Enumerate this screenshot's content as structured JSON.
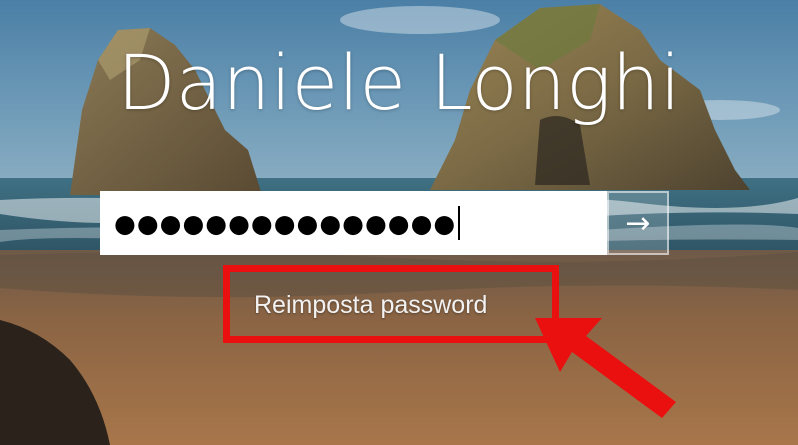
{
  "user": {
    "name": "Daniele Longhi"
  },
  "password": {
    "masked_value": "●●●●●●●●●●●●●●●"
  },
  "submit": {
    "icon": "arrow-right-icon",
    "glyph": "→"
  },
  "reset_link": {
    "label": "Reimposta password"
  },
  "annotation": {
    "color": "#ea1010",
    "kind": "red highlight box with arrow"
  },
  "colors": {
    "sky": "#3b6f95",
    "sea": "#2f5f6f",
    "sand": "#9b6e47"
  }
}
